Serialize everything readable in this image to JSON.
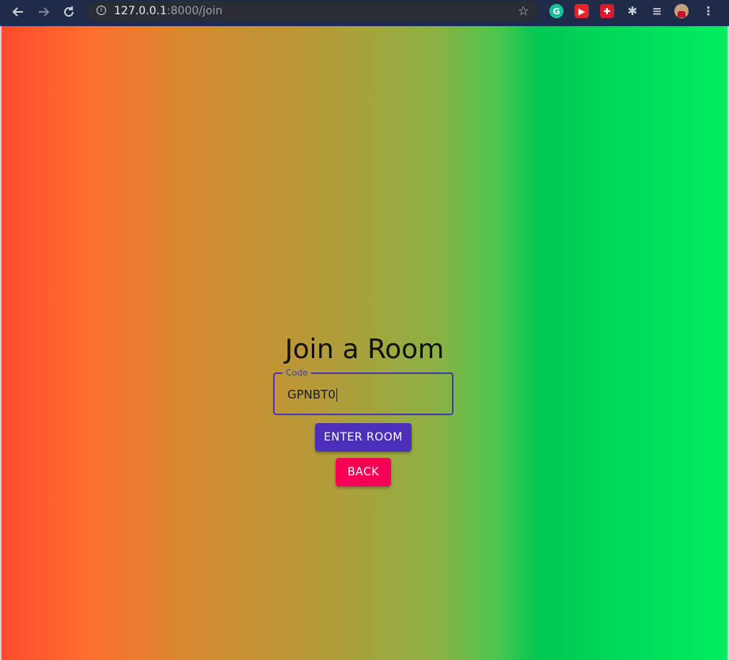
{
  "browser": {
    "url_host": "127.0.0.1",
    "url_path": ":8000/join",
    "extensions": [
      "grammarly-icon",
      "youtube-icon",
      "gift-icon",
      "puzzle-icon",
      "playlist-icon",
      "avatar",
      "kebab-menu-icon"
    ]
  },
  "page": {
    "title": "Join a Room",
    "code_field": {
      "label": "Code",
      "value": "GPNBT0"
    },
    "enter_button": "ENTER ROOM",
    "back_button": "BACK"
  },
  "colors": {
    "primary": "#4b2fb8",
    "secondary": "#f50057"
  }
}
